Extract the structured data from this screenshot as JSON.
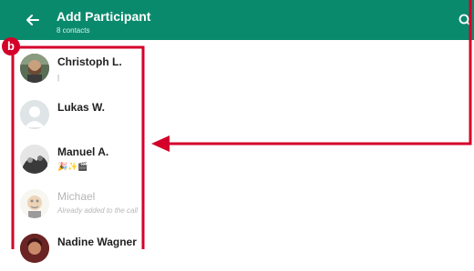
{
  "header": {
    "title": "Add Participant",
    "subtitle": "8 contacts",
    "back_icon": "arrow-left-icon",
    "search_icon": "search-icon",
    "background_color": "#0a8a6d"
  },
  "annotation": {
    "marker_label": "b",
    "color": "#d4002a"
  },
  "contacts": [
    {
      "name": "Christoph L.",
      "status": "|",
      "added": false
    },
    {
      "name": "Lukas W.",
      "status": "",
      "added": false
    },
    {
      "name": "Manuel A.",
      "status": "🎉✨🎬",
      "added": false
    },
    {
      "name": "Michael",
      "status": "Already added to the call",
      "added": true
    },
    {
      "name": "Nadine Wagner",
      "status": "",
      "added": false
    }
  ]
}
